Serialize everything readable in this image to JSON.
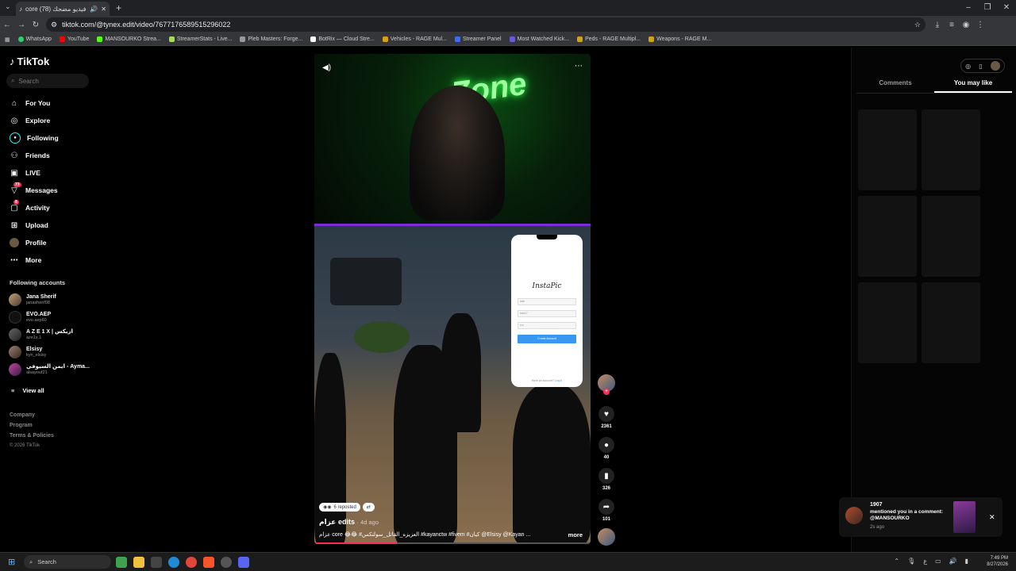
{
  "browser": {
    "tab_title": "core عزام فيديو مضحك (78)",
    "url": "tiktok.com/@tynex.edit/video/7677176589515296022",
    "bookmarks": [
      "WhatsApp",
      "YouTube",
      "MANSOURKO Strea...",
      "StreamerStats - Live...",
      "Pleb Masters: Forge...",
      "BotRix — Cloud Stre...",
      "Vehicles - RAGE Mul...",
      "Streamer Panel",
      "Most Watched Kick...",
      "Peds - RAGE Multipl...",
      "Weapons - RAGE M..."
    ]
  },
  "sidebar": {
    "logo": "TikTok",
    "search_placeholder": "Search",
    "nav": [
      {
        "label": "For You",
        "icon": "home-icon"
      },
      {
        "label": "Explore",
        "icon": "compass-icon"
      },
      {
        "label": "Following",
        "icon": "following-icon"
      },
      {
        "label": "Friends",
        "icon": "friends-icon"
      },
      {
        "label": "LIVE",
        "icon": "live-icon"
      },
      {
        "label": "Messages",
        "icon": "messages-icon",
        "badge": "73"
      },
      {
        "label": "Activity",
        "icon": "activity-icon",
        "badge": "8"
      },
      {
        "label": "Upload",
        "icon": "upload-icon"
      },
      {
        "label": "Profile",
        "icon": "profile-icon"
      },
      {
        "label": "More",
        "icon": "more-icon"
      }
    ],
    "following_title": "Following accounts",
    "accounts": [
      {
        "name": "Jana Sherif",
        "handle": "janasherif08"
      },
      {
        "name": "EVO.AEP",
        "handle": "evo.aep60"
      },
      {
        "name": "A Z E 1 X | ازيكس",
        "handle": "aze1x.1"
      },
      {
        "name": "Elsisy",
        "handle": "kyn_elsisy"
      },
      {
        "name": "ايمن السيوفي - Ayma...",
        "handle": "alsayouf21"
      }
    ],
    "view_all": "View all",
    "footer": [
      "Company",
      "Program",
      "Terms & Policies",
      "© 2026 TikTok"
    ]
  },
  "video": {
    "neon_text": "Zone",
    "phone": {
      "app_name": "InstaPic",
      "field1": "nah",
      "field2": "nan17",
      "field3": "••••",
      "button": "Create Account",
      "footer_text": "Have an account?",
      "footer_link": "Log in"
    },
    "repost_label": "6 reposted",
    "author": "عزام edits",
    "ago": "· 4d ago",
    "caption": "عزام core 😂😂 #العزيزه_القاتل_سولتكس #kayanctw #fivem #كيان @Elsisy @Kayan ...",
    "more_link": "more",
    "progress": 0.3
  },
  "actions": {
    "likes": "2361",
    "comments": "40",
    "saves": "326",
    "shares": "101"
  },
  "right_panel": {
    "tabs": [
      "Comments",
      "You may like"
    ],
    "active_tab": "You may like"
  },
  "notification": {
    "user": "1907",
    "message": "mentioned you in a comment: @MANSOURKO",
    "time": "2s ago"
  },
  "taskbar": {
    "search": "Search",
    "time": "7:49 PM",
    "date": "8/27/2026"
  }
}
